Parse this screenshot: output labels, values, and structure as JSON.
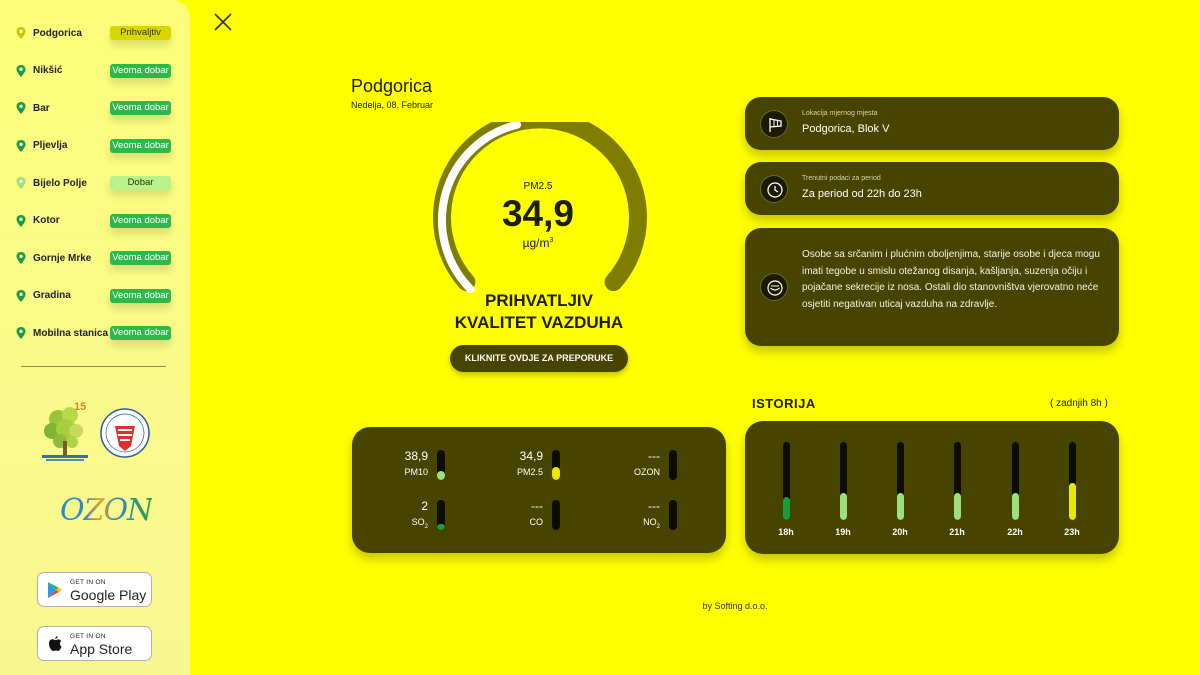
{
  "sidebar": {
    "cities": [
      {
        "name": "Podgorica",
        "status": "Prihvaljtiv",
        "badge_color": "#d8d800",
        "badge_text_color": "#333300",
        "pin_color": "#c9c900"
      },
      {
        "name": "Nikšić",
        "status": "Veoma dobar",
        "badge_color": "#2db84a",
        "badge_text_color": "#ffffff",
        "pin_color": "#1a9e3b"
      },
      {
        "name": "Bar",
        "status": "Veoma dobar",
        "badge_color": "#2db84a",
        "badge_text_color": "#ffffff",
        "pin_color": "#1a9e3b"
      },
      {
        "name": "Pljevlja",
        "status": "Veoma dobar",
        "badge_color": "#2db84a",
        "badge_text_color": "#ffffff",
        "pin_color": "#1a9e3b"
      },
      {
        "name": "Bijelo Polje",
        "status": "Dobar",
        "badge_color": "#b8f28a",
        "badge_text_color": "#333300",
        "pin_color": "#9fe07a"
      },
      {
        "name": "Kotor",
        "status": "Veoma dobar",
        "badge_color": "#2db84a",
        "badge_text_color": "#ffffff",
        "pin_color": "#1a9e3b"
      },
      {
        "name": "Gornje Mrke",
        "status": "Veoma dobar",
        "badge_color": "#2db84a",
        "badge_text_color": "#ffffff",
        "pin_color": "#1a9e3b"
      },
      {
        "name": "Gradina",
        "status": "Veoma dobar",
        "badge_color": "#2db84a",
        "badge_text_color": "#ffffff",
        "pin_color": "#1a9e3b"
      },
      {
        "name": "Mobilna stanica",
        "status": "Veoma dobar",
        "badge_color": "#2db84a",
        "badge_text_color": "#ffffff",
        "pin_color": "#1a9e3b"
      }
    ],
    "ozon_logo": "OZON",
    "tree_logo_badge": "15",
    "google_play": {
      "small": "GET IN ON",
      "big": "Google Play"
    },
    "app_store": {
      "small": "GET IN ON",
      "big": "App Store"
    }
  },
  "main": {
    "city": "Podgorica",
    "date": "Nedelja, 08. Februar",
    "pm_label": "PM2.5",
    "pm_value": "34,9",
    "pm_unit": "µg/m",
    "pm_unit_exp": "3",
    "gauge_level": 0.45,
    "quality_line1": "PRIHVATLJIV",
    "quality_line2": "KVALITET VAZDUHA",
    "recommend_button": "KLIKNITE OVDJE ZA PREPORUKE"
  },
  "info": {
    "location_label": "Lokacija mjernog mjesta",
    "location_value": "Podgorica, Blok V",
    "period_label": "Trenutni podaci za period",
    "period_value": "Za period od 22h do 23h",
    "advice": "Osobe sa srčanim i plućnim oboljenjima, starije osobe i djeca mogu imati tegobe u smislu otežanog disanja, kašljanja, suzenja očiju i pojačane sekrecije iz nosa. Ostali dio stanovništva vjerovatno neće osjetiti negativan uticaj vazduha na zdravlje."
  },
  "pollutants": [
    {
      "value": "38,9",
      "name": "PM10",
      "sub": "",
      "level": 0.3,
      "color": "#9be07a"
    },
    {
      "value": "34,9",
      "name": "PM2.5",
      "sub": "",
      "level": 0.45,
      "color": "#e8e800"
    },
    {
      "value": "---",
      "name": "OZON",
      "sub": "",
      "level": 0,
      "color": "#9be07a"
    },
    {
      "value": "2",
      "name": "SO",
      "sub": "2",
      "level": 0.2,
      "color": "#1a9e3b"
    },
    {
      "value": "---",
      "name": "CO",
      "sub": "",
      "level": 0,
      "color": "#9be07a"
    },
    {
      "value": "---",
      "name": "NO",
      "sub": "2",
      "level": 0,
      "color": "#9be07a"
    }
  ],
  "history": {
    "title": "ISTORIJA",
    "subtitle": "( zadnjih 8h )",
    "bars": [
      {
        "label": "18h",
        "level": 0.3,
        "color": "#1a9e3b"
      },
      {
        "label": "19h",
        "level": 0.35,
        "color": "#9be07a"
      },
      {
        "label": "20h",
        "level": 0.35,
        "color": "#9be07a"
      },
      {
        "label": "21h",
        "level": 0.35,
        "color": "#9be07a"
      },
      {
        "label": "22h",
        "level": 0.35,
        "color": "#9be07a"
      },
      {
        "label": "23h",
        "level": 0.48,
        "color": "#e8e800"
      }
    ]
  },
  "footer": "by Softing d.o.o."
}
